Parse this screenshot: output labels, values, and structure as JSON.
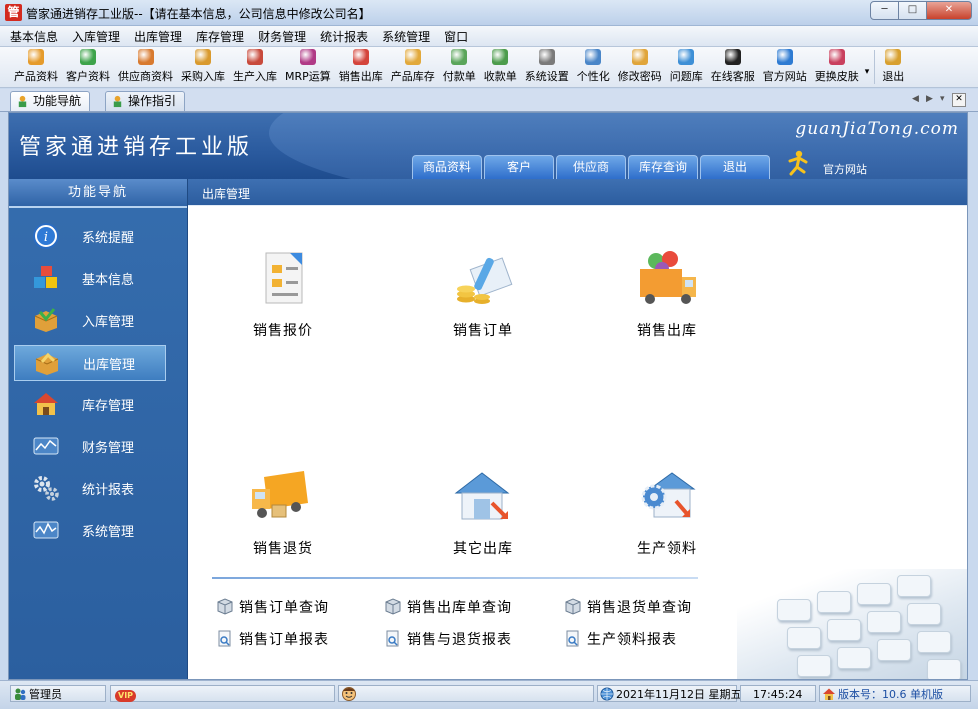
{
  "window": {
    "app_icon_char": "管",
    "title": "管家通进销存工业版--【请在基本信息，公司信息中修改公司名】",
    "controls": {
      "minimize": "─",
      "maximize": "□",
      "close": "✕"
    }
  },
  "menubar": [
    "基本信息",
    "入库管理",
    "出库管理",
    "库存管理",
    "财务管理",
    "统计报表",
    "系统管理",
    "窗口"
  ],
  "toolbar": [
    {
      "label": "产品资料",
      "icon": "product-icon",
      "color": "#e59b2b"
    },
    {
      "label": "客户资料",
      "icon": "customer-icon",
      "color": "#3da34a"
    },
    {
      "label": "供应商资料",
      "icon": "supplier-icon",
      "color": "#d87a2f"
    },
    {
      "label": "采购入库",
      "icon": "purchase-icon",
      "color": "#d99a2e"
    },
    {
      "label": "生产入库",
      "icon": "production-icon",
      "color": "#c84a3c"
    },
    {
      "label": "MRP运算",
      "icon": "mrp-icon",
      "color": "#b03a86"
    },
    {
      "label": "销售出库",
      "icon": "sales-out-icon",
      "color": "#d4443b"
    },
    {
      "label": "产品库存",
      "icon": "stock-icon",
      "color": "#e2a93b"
    },
    {
      "label": "付款单",
      "icon": "payment-icon",
      "color": "#5aa55a"
    },
    {
      "label": "收款单",
      "icon": "receipt-icon",
      "color": "#4c9c4c"
    },
    {
      "label": "系统设置",
      "icon": "settings-icon",
      "color": "#7a7a7a"
    },
    {
      "label": "个性化",
      "icon": "personalize-icon",
      "color": "#4a86c8"
    },
    {
      "label": "修改密码",
      "icon": "password-icon",
      "color": "#e0a53a"
    },
    {
      "label": "问题库",
      "icon": "faq-icon",
      "color": "#3d8fd6"
    },
    {
      "label": "在线客服",
      "icon": "online-service-icon",
      "color": "#222222"
    },
    {
      "label": "官方网站",
      "icon": "ie-icon",
      "color": "#2e7bd2"
    },
    {
      "label": "更换皮肤",
      "icon": "skin-icon",
      "color": "#c9405e"
    },
    {
      "label": "退出",
      "icon": "exit-icon",
      "color": "#d8a02f"
    }
  ],
  "tabs": [
    {
      "label": "功能导航",
      "active": true
    },
    {
      "label": "操作指引",
      "active": false
    }
  ],
  "tab_controls": {
    "prev": "◀",
    "next": "▶",
    "list": "▾",
    "close": "✕"
  },
  "banner": {
    "title": "管家通进销存工业版",
    "brand": "guanJiaTong.com",
    "tabs": [
      "商品资料",
      "客户",
      "供应商",
      "库存查询",
      "退出"
    ],
    "site_label": "官方网站"
  },
  "sidebar": {
    "header": "功能导航",
    "items": [
      {
        "label": "系统提醒",
        "icon": "info-icon",
        "active": false
      },
      {
        "label": "基本信息",
        "icon": "cubes-icon",
        "active": false
      },
      {
        "label": "入库管理",
        "icon": "box-in-icon",
        "active": false
      },
      {
        "label": "出库管理",
        "icon": "box-out-icon",
        "active": true
      },
      {
        "label": "库存管理",
        "icon": "warehouse-icon",
        "active": false
      },
      {
        "label": "财务管理",
        "icon": "finance-icon",
        "active": false
      },
      {
        "label": "统计报表",
        "icon": "gears-icon",
        "active": false
      },
      {
        "label": "系统管理",
        "icon": "system-icon",
        "active": false
      }
    ]
  },
  "panel": {
    "title": "出库管理",
    "modules": [
      {
        "label": "销售报价",
        "icon": "quote-document-icon"
      },
      {
        "label": "销售订单",
        "icon": "order-coins-icon"
      },
      {
        "label": "销售出库",
        "icon": "delivery-truck-icon"
      },
      {
        "label": "销售退货",
        "icon": "return-truck-icon"
      },
      {
        "label": "其它出库",
        "icon": "other-outbound-house-icon"
      },
      {
        "label": "生产领料",
        "icon": "production-material-icon"
      }
    ],
    "queries": [
      {
        "label": "销售订单查询",
        "icon": "query-cube-icon"
      },
      {
        "label": "销售出库单查询",
        "icon": "query-cube-icon"
      },
      {
        "label": "销售退货单查询",
        "icon": "query-cube-icon"
      },
      {
        "label": "销售订单报表",
        "icon": "report-icon"
      },
      {
        "label": "销售与退货报表",
        "icon": "report-icon"
      },
      {
        "label": "生产领料报表",
        "icon": "report-icon"
      }
    ]
  },
  "statusbar": {
    "user": "管理员",
    "vip": "VIP",
    "datetime": "2021年11月12日 星期五",
    "time": "17:45:24",
    "version": "版本号：10.6 单机版"
  }
}
